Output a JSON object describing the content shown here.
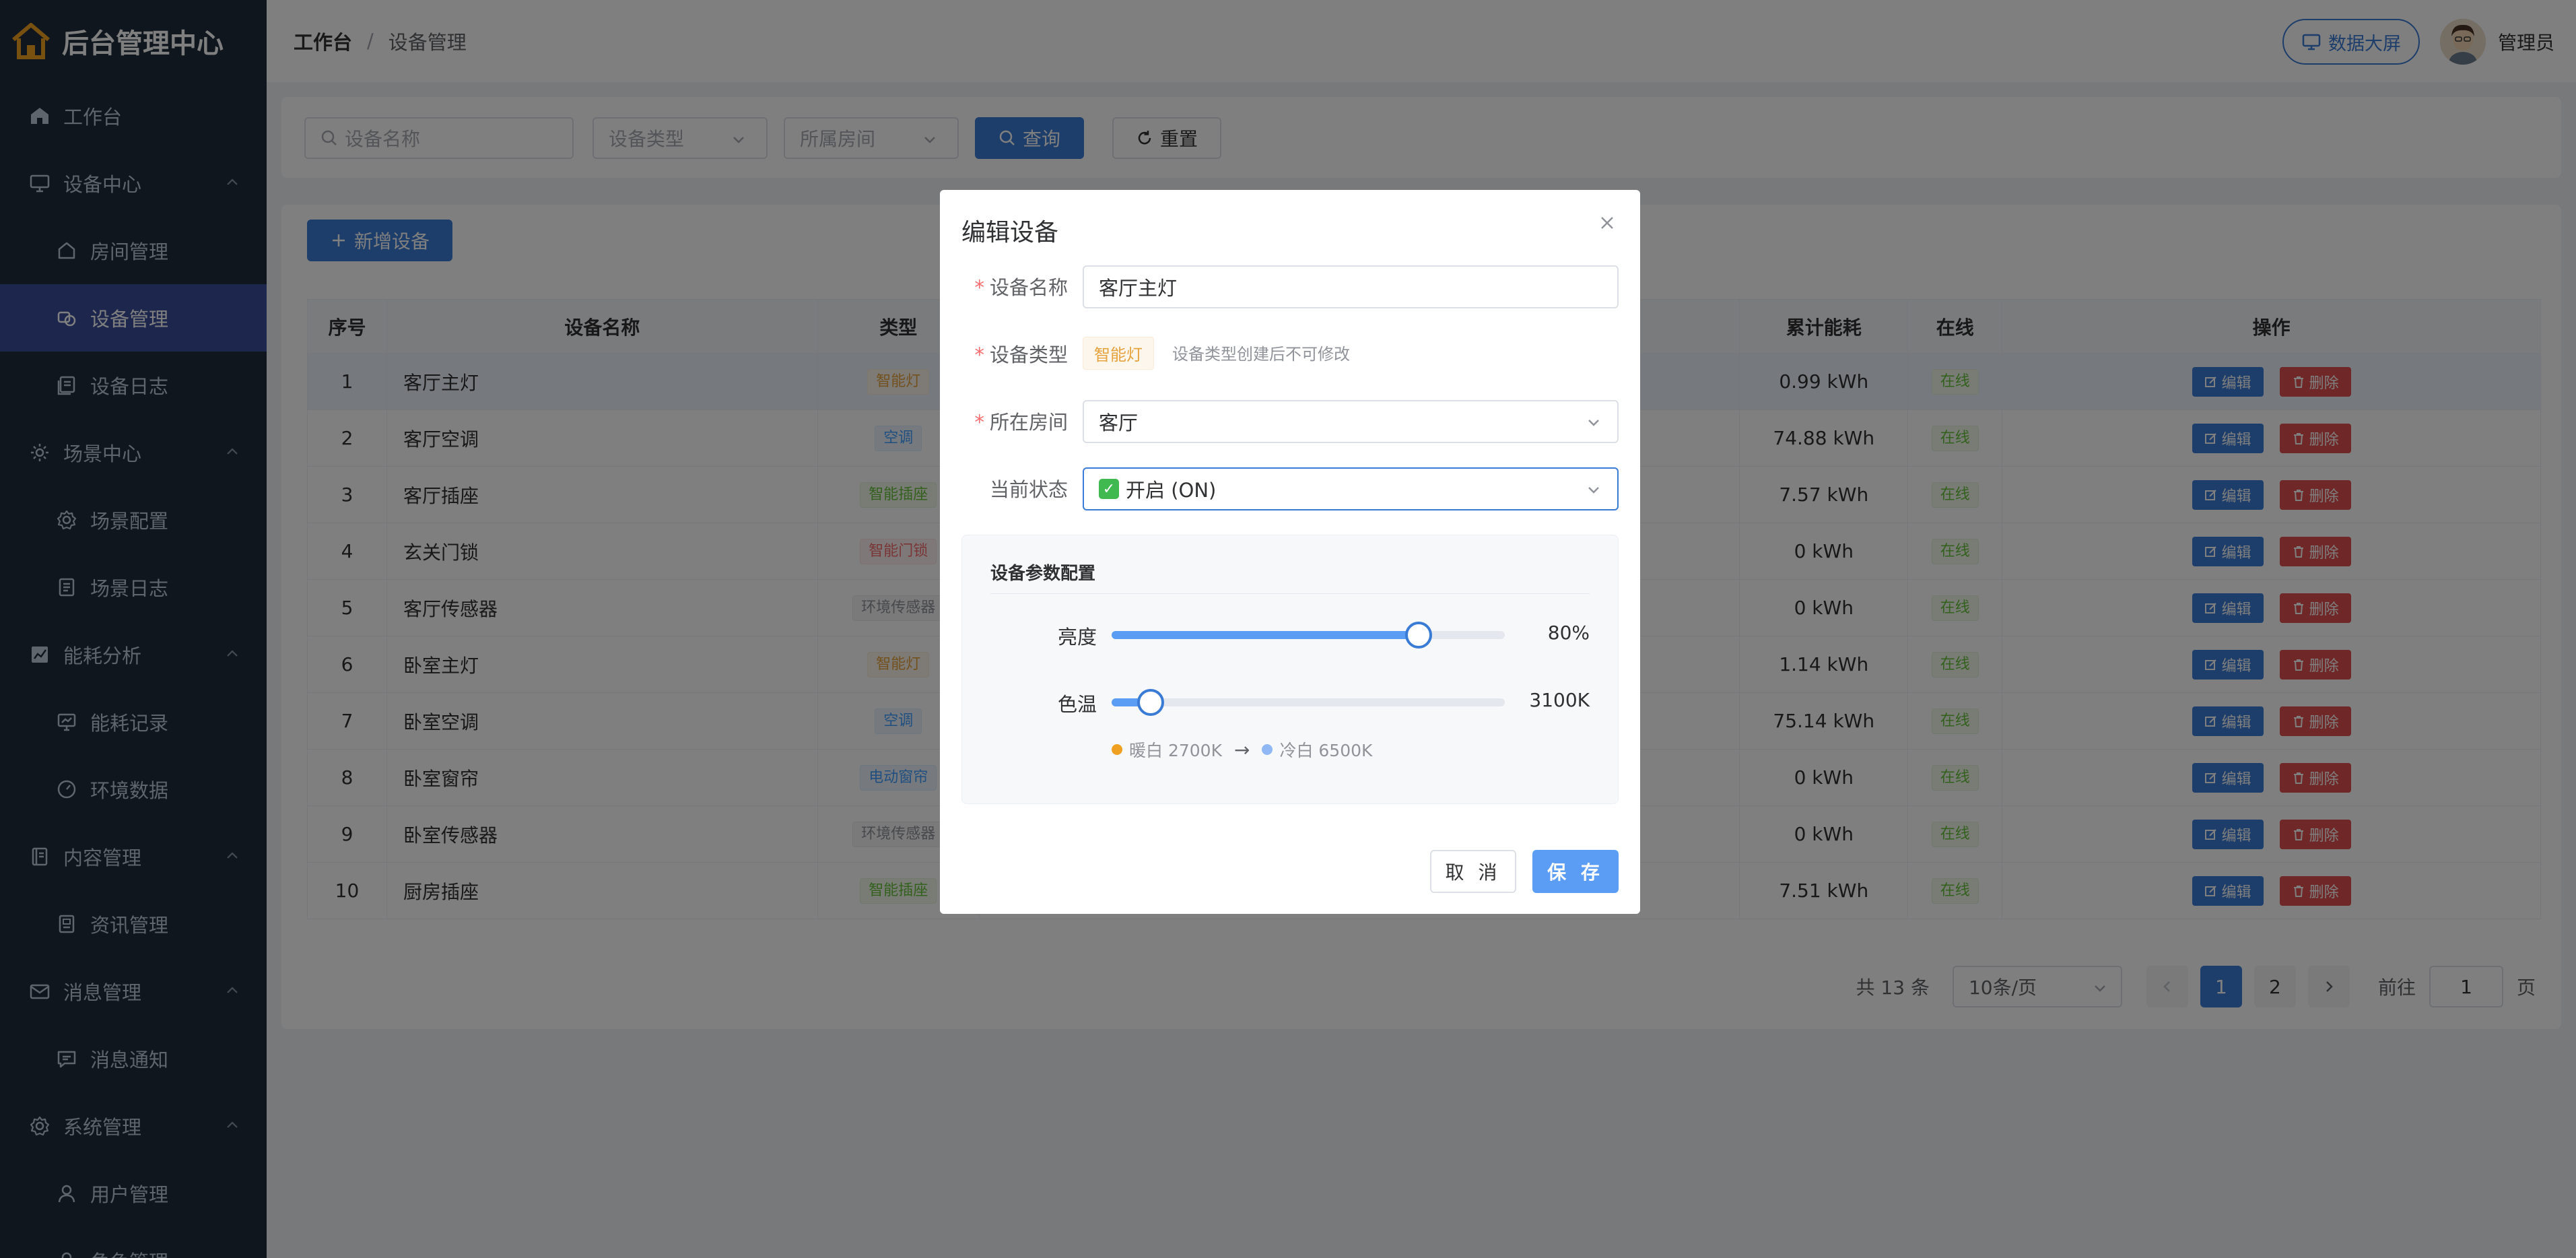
{
  "app": {
    "title": "后台管理中心"
  },
  "sidebar": {
    "items": [
      {
        "label": "工作台",
        "level": "top",
        "icon": "home-icon"
      },
      {
        "label": "设备中心",
        "level": "top",
        "icon": "monitor-icon",
        "expandable": true
      },
      {
        "label": "房间管理",
        "level": "sub",
        "icon": "house-icon"
      },
      {
        "label": "设备管理",
        "level": "sub",
        "icon": "device-icon",
        "active": true
      },
      {
        "label": "设备日志",
        "level": "sub",
        "icon": "log-icon"
      },
      {
        "label": "场景中心",
        "level": "top",
        "icon": "sun-icon",
        "expandable": true
      },
      {
        "label": "场景配置",
        "level": "sub",
        "icon": "gear-icon"
      },
      {
        "label": "场景日志",
        "level": "sub",
        "icon": "document-icon"
      },
      {
        "label": "能耗分析",
        "level": "top",
        "icon": "chart-icon",
        "expandable": true
      },
      {
        "label": "能耗记录",
        "level": "sub",
        "icon": "screen-chart-icon"
      },
      {
        "label": "环境数据",
        "level": "sub",
        "icon": "gauge-icon"
      },
      {
        "label": "内容管理",
        "level": "top",
        "icon": "notebook-icon",
        "expandable": true
      },
      {
        "label": "资讯管理",
        "level": "sub",
        "icon": "news-icon"
      },
      {
        "label": "消息管理",
        "level": "top",
        "icon": "mail-icon",
        "expandable": true
      },
      {
        "label": "消息通知",
        "level": "sub",
        "icon": "chat-icon"
      },
      {
        "label": "系统管理",
        "level": "top",
        "icon": "gear-icon",
        "expandable": true
      },
      {
        "label": "用户管理",
        "level": "sub",
        "icon": "user-icon"
      },
      {
        "label": "角色管理",
        "level": "sub",
        "icon": "role-icon"
      }
    ]
  },
  "header": {
    "breadcrumb": [
      "工作台",
      "设备管理"
    ],
    "big_screen_label": "数据大屏",
    "user_name": "管理员"
  },
  "search": {
    "name_placeholder": "设备名称",
    "type_placeholder": "设备类型",
    "room_placeholder": "所属房间",
    "query_label": "查询",
    "reset_label": "重置"
  },
  "toolbar": {
    "add_label": "新增设备"
  },
  "table": {
    "columns": [
      "序号",
      "设备名称",
      "类型",
      "累计能耗",
      "在线",
      "操作"
    ],
    "edit_label": "编辑",
    "delete_label": "删除",
    "rows": [
      {
        "no": "1",
        "name": "客厅主灯",
        "type": "智能灯",
        "type_style": "light",
        "energy": "0.99 kWh",
        "online": "在线",
        "highlight": true
      },
      {
        "no": "2",
        "name": "客厅空调",
        "type": "空调",
        "type_style": "ac",
        "energy": "74.88 kWh",
        "online": "在线"
      },
      {
        "no": "3",
        "name": "客厅插座",
        "type": "智能插座",
        "type_style": "plug",
        "energy": "7.57 kWh",
        "online": "在线"
      },
      {
        "no": "4",
        "name": "玄关门锁",
        "type": "智能门锁",
        "type_style": "lock",
        "energy": "0 kWh",
        "online": "在线"
      },
      {
        "no": "5",
        "name": "客厅传感器",
        "type": "环境传感器",
        "type_style": "sensor",
        "energy": "0 kWh",
        "online": "在线"
      },
      {
        "no": "6",
        "name": "卧室主灯",
        "type": "智能灯",
        "type_style": "light",
        "energy": "1.14 kWh",
        "online": "在线"
      },
      {
        "no": "7",
        "name": "卧室空调",
        "type": "空调",
        "type_style": "ac",
        "energy": "75.14 kWh",
        "online": "在线"
      },
      {
        "no": "8",
        "name": "卧室窗帘",
        "type": "电动窗帘",
        "type_style": "ac",
        "energy": "0 kWh",
        "online": "在线"
      },
      {
        "no": "9",
        "name": "卧室传感器",
        "type": "环境传感器",
        "type_style": "sensor",
        "energy": "0 kWh",
        "online": "在线"
      },
      {
        "no": "10",
        "name": "厨房插座",
        "type": "智能插座",
        "type_style": "plug",
        "energy": "7.51 kWh",
        "online": "在线"
      }
    ]
  },
  "pagination": {
    "total": "共 13 条",
    "page_size": "10条/页",
    "pages": [
      "1",
      "2"
    ],
    "current": "1",
    "goto_label": "前往",
    "goto_value": "1",
    "page_suffix": "页"
  },
  "dialog": {
    "title": "编辑设备",
    "name_label": "设备名称",
    "name_value": "客厅主灯",
    "type_label": "设备类型",
    "type_value": "智能灯",
    "type_tip": "设备类型创建后不可修改",
    "room_label": "所在房间",
    "room_value": "客厅",
    "state_label": "当前状态",
    "state_value": "开启 (ON)",
    "params_title": "设备参数配置",
    "brightness_label": "亮度",
    "brightness_value": "80%",
    "brightness_fraction": 0.78,
    "color_temp_label": "色温",
    "color_temp_value": "3100K",
    "color_temp_fraction": 0.1,
    "warm_label": "暖白 2700K",
    "cool_label": "冷白 6500K",
    "arrow": "→",
    "cancel_label": "取 消",
    "save_label": "保 存",
    "colors": {
      "warm": "#f0a020",
      "cool": "#8fb8f5",
      "accent": "#3a7bd5"
    }
  }
}
